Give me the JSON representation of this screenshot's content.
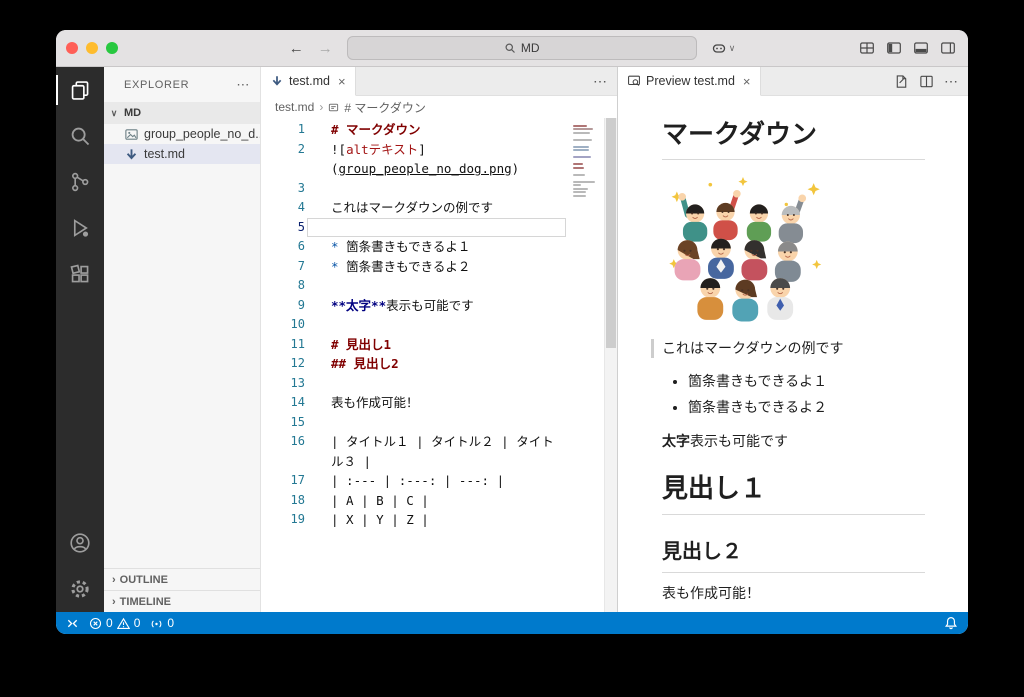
{
  "theme": {
    "status_bar": "#007acc",
    "activity_bar": "#2c2c2c",
    "selection": "#e4e6f1",
    "accent_blue": "#0451a5",
    "heading_red": "#800000"
  },
  "icons": {
    "close": "×",
    "more": "⋯",
    "chevron_down": "∨",
    "chevron_right": "›",
    "back": "←",
    "forward": "→",
    "crumb_sep": "›"
  },
  "title_bar": {
    "search": "MD"
  },
  "sidebar": {
    "title": "EXPLORER",
    "folder": "MD",
    "files": [
      {
        "name": "group_people_no_d...",
        "type": "image"
      },
      {
        "name": "test.md",
        "type": "markdown",
        "selected": true
      }
    ],
    "sections": [
      {
        "label": "OUTLINE"
      },
      {
        "label": "TIMELINE"
      }
    ]
  },
  "editor": {
    "tab": "test.md",
    "breadcrumb": {
      "file": "test.md",
      "symbol": "# マークダウン"
    },
    "lines": [
      {
        "num": "1",
        "segments": [
          {
            "t": "# マークダウン",
            "c": "h"
          }
        ]
      },
      {
        "num": "2",
        "segments": [
          {
            "t": "![",
            "c": "p"
          },
          {
            "t": "altテキスト",
            "c": "alt"
          },
          {
            "t": "]",
            "c": "p"
          }
        ]
      },
      {
        "num": "",
        "segments": [
          {
            "t": "(",
            "c": "p"
          },
          {
            "t": "group_people_no_dog.png",
            "c": "link"
          },
          {
            "t": ")",
            "c": "p"
          }
        ]
      },
      {
        "num": "3",
        "segments": []
      },
      {
        "num": "4",
        "segments": [
          {
            "t": "これはマークダウンの例です",
            "c": "p"
          }
        ]
      },
      {
        "num": "5",
        "segments": [],
        "cursor": true
      },
      {
        "num": "6",
        "segments": [
          {
            "t": "* ",
            "c": "b"
          },
          {
            "t": "箇条書きもできるよ１",
            "c": "p"
          }
        ]
      },
      {
        "num": "7",
        "segments": [
          {
            "t": "* ",
            "c": "b"
          },
          {
            "t": "箇条書きもできるよ２",
            "c": "p"
          }
        ]
      },
      {
        "num": "8",
        "segments": []
      },
      {
        "num": "9",
        "segments": [
          {
            "t": "**太字**",
            "c": "bold"
          },
          {
            "t": "表示も可能です",
            "c": "p"
          }
        ]
      },
      {
        "num": "10",
        "segments": []
      },
      {
        "num": "11",
        "segments": [
          {
            "t": "# 見出し1",
            "c": "h"
          }
        ]
      },
      {
        "num": "12",
        "segments": [
          {
            "t": "## 見出し2",
            "c": "h"
          }
        ]
      },
      {
        "num": "13",
        "segments": []
      },
      {
        "num": "14",
        "segments": [
          {
            "t": "表も作成可能！",
            "c": "p"
          }
        ]
      },
      {
        "num": "15",
        "segments": []
      },
      {
        "num": "16",
        "segments": [
          {
            "t": "| タイトル１ | タイトル２ | タイト",
            "c": "p"
          }
        ]
      },
      {
        "num": "",
        "segments": [
          {
            "t": "ル３ |",
            "c": "p"
          }
        ]
      },
      {
        "num": "17",
        "segments": [
          {
            "t": "| :--- | :---: | ---: |",
            "c": "p"
          }
        ]
      },
      {
        "num": "18",
        "segments": [
          {
            "t": "| A | B | C |",
            "c": "p"
          }
        ]
      },
      {
        "num": "19",
        "segments": [
          {
            "t": "| X | Y | Z |",
            "c": "p"
          }
        ]
      }
    ]
  },
  "preview": {
    "tab": "Preview test.md",
    "h1": "マークダウン",
    "paragraph": "これはマークダウンの例です",
    "bullets": [
      "箇条書きもできるよ１",
      "箇条書きもできるよ２"
    ],
    "bold": "太字",
    "bold_rest": "表示も可能です",
    "heading1": "見出し１",
    "heading2": "見出し２",
    "table_note": "表も作成可能！"
  },
  "status_bar": {
    "errors": "0",
    "warnings": "0",
    "ports": "0"
  }
}
